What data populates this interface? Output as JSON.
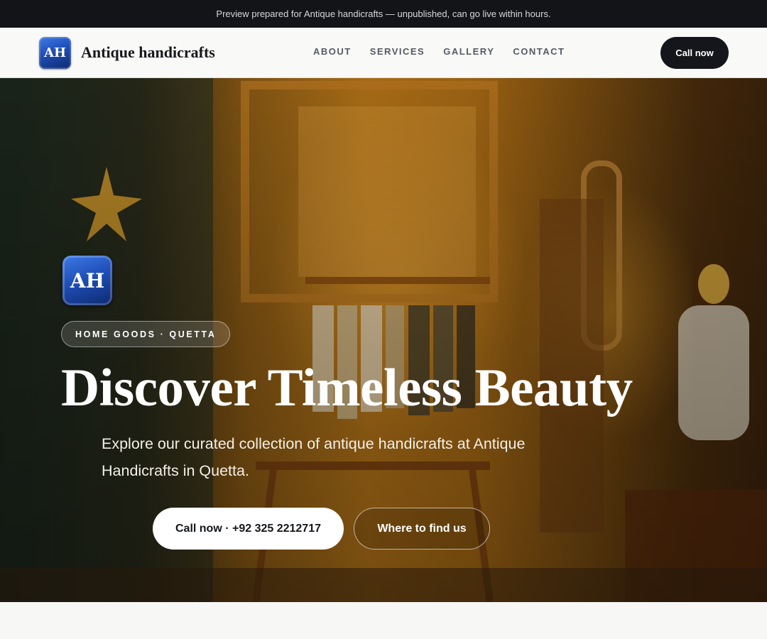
{
  "announcement": "Preview prepared for Antique handicrafts — unpublished, can go live within hours.",
  "brand": {
    "initials": "AH",
    "name": "Antique handicrafts",
    "badge_color": "#1f4fb8"
  },
  "nav": {
    "links": [
      "ABOUT",
      "SERVICES",
      "GALLERY",
      "CONTACT"
    ],
    "cta_label": "Call now"
  },
  "hero": {
    "logo_initials": "AH",
    "tag": "HOME GOODS · QUETTA",
    "title": "Discover Timeless Beauty",
    "subtitle": "Explore our curated collection of antique handicrafts at Antique Handicrafts in Quetta.",
    "primary_button": "Call now · +92 325 2212717",
    "secondary_button": "Where to find us"
  },
  "colors": {
    "dark": "#121418",
    "accent": "#14161b",
    "page_bg": "#f7f7f5"
  }
}
